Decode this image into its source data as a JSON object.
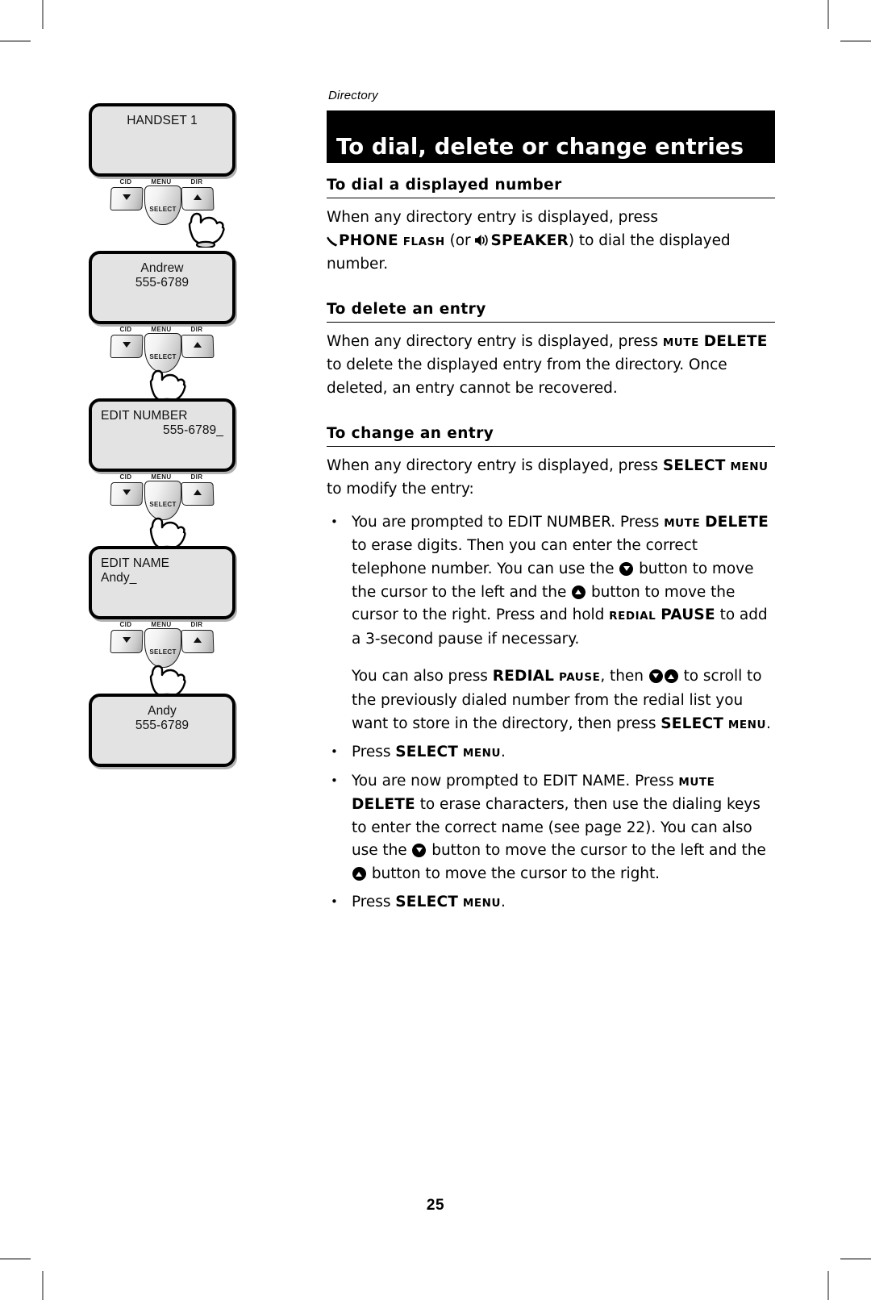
{
  "page": {
    "running_head": "Directory",
    "title": "To dial, delete or change entries",
    "page_number": "25"
  },
  "illustrations": [
    {
      "name": "handset-1-screen",
      "lines": [
        {
          "text": "HANDSET 1",
          "align": "center"
        }
      ],
      "keys": {
        "left_label": "CID",
        "center_label": "MENU",
        "center_text": "SELECT",
        "right_label": "DIR"
      },
      "hand_target": "dir-button"
    },
    {
      "name": "directory-entry-screen",
      "lines": [
        {
          "text": "Andrew",
          "align": "center"
        },
        {
          "text": "555-6789",
          "align": "center"
        }
      ],
      "keys": {
        "left_label": "CID",
        "center_label": "MENU",
        "center_text": "SELECT",
        "right_label": "DIR"
      },
      "hand_target": "select-button"
    },
    {
      "name": "edit-number-screen",
      "lines": [
        {
          "text": "EDIT NUMBER",
          "align": "left"
        },
        {
          "text": "555-6789_",
          "align": "right"
        }
      ],
      "keys": {
        "left_label": "CID",
        "center_label": "MENU",
        "center_text": "SELECT",
        "right_label": "DIR"
      },
      "hand_target": "select-button"
    },
    {
      "name": "edit-name-screen",
      "lines": [
        {
          "text": "EDIT NAME",
          "align": "left"
        },
        {
          "text": "Andy_",
          "align": "left"
        }
      ],
      "keys": {
        "left_label": "CID",
        "center_label": "MENU",
        "center_text": "SELECT",
        "right_label": "DIR"
      },
      "hand_target": "select-button"
    },
    {
      "name": "saved-entry-screen",
      "lines": [
        {
          "text": "Andy",
          "align": "center"
        },
        {
          "text": "555-6789",
          "align": "center"
        }
      ],
      "keys": null,
      "hand_target": null
    }
  ],
  "sections": {
    "dial": {
      "heading": "To dial a displayed number",
      "p1_a": "When any directory entry is displayed, press",
      "p1_phone": "PHONE",
      "p1_flash": "FLASH",
      "p1_b": " (or ",
      "p1_speaker": "SPEAKER",
      "p1_c": ") to dial the displayed number."
    },
    "delete": {
      "heading": "To delete an entry",
      "p1_a": "When any directory entry is displayed, press ",
      "p1_mute": "MUTE",
      "p1_delete": "DELETE",
      "p1_b": " to delete the displayed entry from the directory. Once deleted, an entry cannot be recovered."
    },
    "change": {
      "heading": "To change an entry",
      "p1_a": "When any directory entry is displayed, press ",
      "p1_select": "SELECT",
      "p1_menu": "MENU",
      "p1_b": " to modify the entry:",
      "bullets": [
        {
          "a": "You are prompted to EDIT NUMBER.  Press ",
          "mute": "MUTE",
          "delete": "DELETE",
          "b": " to erase digits. Then you can enter the correct telephone number. You can use the ",
          "c": " button to move the cursor to the left and the ",
          "d": " button to move the cursor to the right. Press and hold ",
          "redial": "REDIAL",
          "pause": "PAUSE",
          "e": " to add a 3-second pause if necessary.",
          "sub_a": "You can also press ",
          "sub_redial": "REDIAL",
          "sub_pause": "PAUSE",
          "sub_b": ", then ",
          "sub_c": " to scroll to the previously dialed number from the redial list you want to store in the directory, then press ",
          "sub_select": "SELECT",
          "sub_menu": "MENU",
          "sub_d": "."
        },
        {
          "a": "Press ",
          "select": "SELECT",
          "menu": "MENU",
          "b": "."
        },
        {
          "a": "You are now prompted to EDIT NAME. Press ",
          "mute": "MUTE",
          "delete": "DELETE",
          "b": " to erase characters, then use the dialing keys to enter the correct name (see page 22). You can also use the ",
          "c": " button to move the cursor to the left and the ",
          "d": " button to move the cursor to the right."
        },
        {
          "a": "Press ",
          "select": "SELECT",
          "menu": "MENU",
          "b": "."
        }
      ]
    }
  },
  "colors": {
    "title_bar_bg": "#000000",
    "title_bar_fg": "#ffffff",
    "lcd_bg": "#e3e3e3",
    "page_bg": "#ffffff",
    "crop_mark": "#8a8a8a"
  }
}
